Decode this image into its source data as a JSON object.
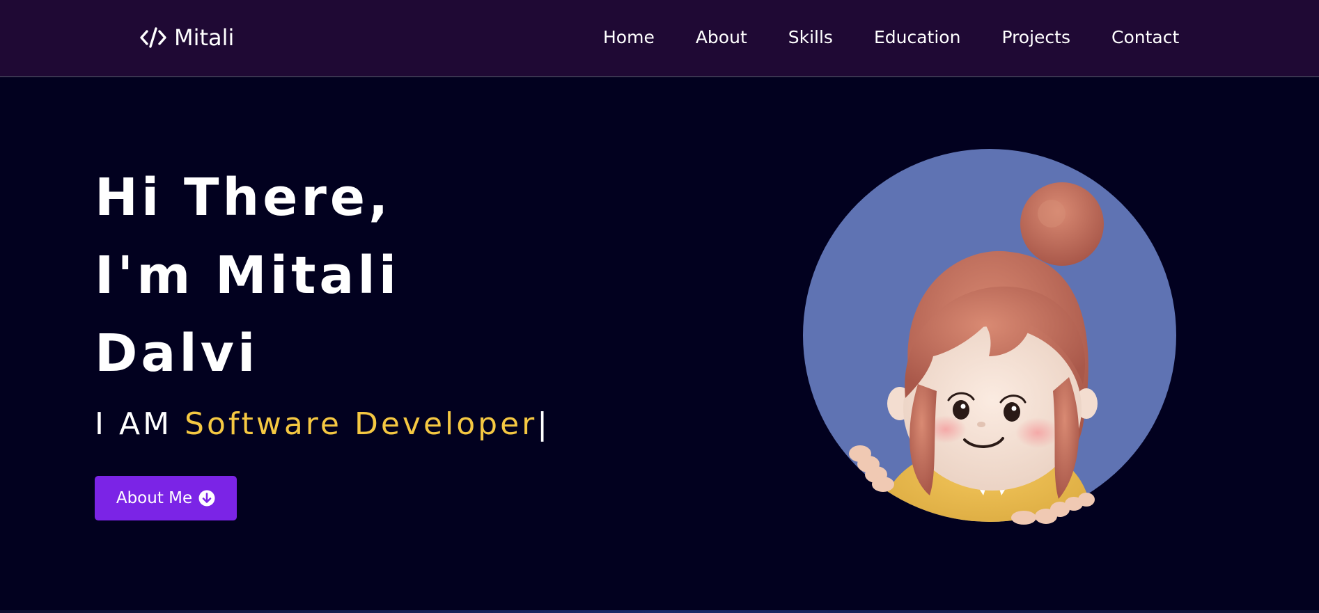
{
  "navbar": {
    "brand": {
      "icon": "code-icon",
      "name": "Mitali"
    },
    "links": [
      {
        "label": "Home"
      },
      {
        "label": "About"
      },
      {
        "label": "Skills"
      },
      {
        "label": "Education"
      },
      {
        "label": "Projects"
      },
      {
        "label": "Contact"
      }
    ]
  },
  "hero": {
    "title_lines": [
      "Hi There,",
      "I'm Mitali",
      "Dalvi"
    ],
    "typed_prefix": "I AM ",
    "typed_text": "Software Developer",
    "cursor": "|",
    "button": {
      "label": "About Me",
      "icon": "arrow-down-circle-icon"
    },
    "avatar_icon": "avatar-illustration"
  },
  "colors": {
    "navbar_bg": "#1f0934",
    "page_bg": "#02011f",
    "accent_yellow": "#f5c842",
    "button_purple": "#7b24e6",
    "avatar_circle": "#5f73b3"
  }
}
